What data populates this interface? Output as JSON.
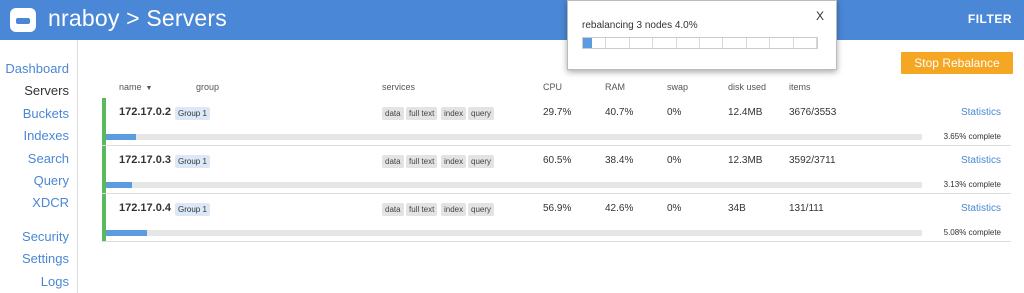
{
  "header": {
    "title": "nraboy > Servers",
    "filter_label": "FILTER",
    "brand_color": "#4a87d6"
  },
  "sidebar": {
    "items": [
      {
        "label": "Dashboard",
        "active": false
      },
      {
        "label": "Servers",
        "active": true
      },
      {
        "label": "Buckets",
        "active": false
      },
      {
        "label": "Indexes",
        "active": false
      },
      {
        "label": "Search",
        "active": false
      },
      {
        "label": "Query",
        "active": false
      },
      {
        "label": "XDCR",
        "active": false
      },
      {
        "label": "Security",
        "active": false
      },
      {
        "label": "Settings",
        "active": false
      },
      {
        "label": "Logs",
        "active": false
      }
    ]
  },
  "toolbar": {
    "stop_rebalance_label": "Stop Rebalance"
  },
  "dialog": {
    "message": "rebalancing 3 nodes 4.0%",
    "close_label": "X",
    "progress": 0.04
  },
  "table": {
    "columns": {
      "name": "name",
      "group": "group",
      "services": "services",
      "cpu": "CPU",
      "ram": "RAM",
      "swap": "swap",
      "disk": "disk used",
      "items": "items"
    },
    "rows": [
      {
        "name": "172.17.0.2",
        "group": "Group 1",
        "services": [
          "data",
          "full text",
          "index",
          "query"
        ],
        "cpu": "29.7%",
        "ram": "40.7%",
        "swap": "0%",
        "disk": "12.4MB",
        "items": "3676/3553",
        "stats_label": "Statistics",
        "progress_text": "3.65% complete",
        "progress": 0.0365
      },
      {
        "name": "172.17.0.3",
        "group": "Group 1",
        "services": [
          "data",
          "full text",
          "index",
          "query"
        ],
        "cpu": "60.5%",
        "ram": "38.4%",
        "swap": "0%",
        "disk": "12.3MB",
        "items": "3592/3711",
        "stats_label": "Statistics",
        "progress_text": "3.13% complete",
        "progress": 0.0313
      },
      {
        "name": "172.17.0.4",
        "group": "Group 1",
        "services": [
          "data",
          "full text",
          "index",
          "query"
        ],
        "cpu": "56.9%",
        "ram": "42.6%",
        "swap": "0%",
        "disk": "34B",
        "items": "131/111",
        "stats_label": "Statistics",
        "progress_text": "5.08% complete",
        "progress": 0.0508
      }
    ]
  },
  "icons": {
    "logo": "couchbase-logo-icon",
    "sort": "sort-down-icon"
  }
}
